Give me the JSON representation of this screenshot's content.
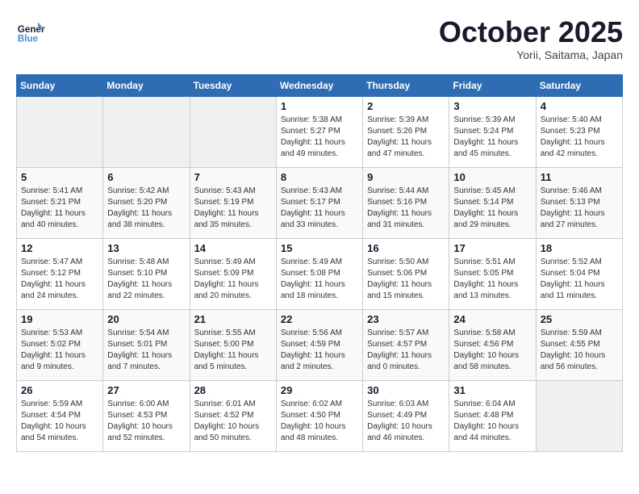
{
  "header": {
    "logo_line1": "General",
    "logo_line2": "Blue",
    "month": "October 2025",
    "location": "Yorii, Saitama, Japan"
  },
  "weekdays": [
    "Sunday",
    "Monday",
    "Tuesday",
    "Wednesday",
    "Thursday",
    "Friday",
    "Saturday"
  ],
  "weeks": [
    [
      {
        "day": "",
        "info": ""
      },
      {
        "day": "",
        "info": ""
      },
      {
        "day": "",
        "info": ""
      },
      {
        "day": "1",
        "info": "Sunrise: 5:38 AM\nSunset: 5:27 PM\nDaylight: 11 hours\nand 49 minutes."
      },
      {
        "day": "2",
        "info": "Sunrise: 5:39 AM\nSunset: 5:26 PM\nDaylight: 11 hours\nand 47 minutes."
      },
      {
        "day": "3",
        "info": "Sunrise: 5:39 AM\nSunset: 5:24 PM\nDaylight: 11 hours\nand 45 minutes."
      },
      {
        "day": "4",
        "info": "Sunrise: 5:40 AM\nSunset: 5:23 PM\nDaylight: 11 hours\nand 42 minutes."
      }
    ],
    [
      {
        "day": "5",
        "info": "Sunrise: 5:41 AM\nSunset: 5:21 PM\nDaylight: 11 hours\nand 40 minutes."
      },
      {
        "day": "6",
        "info": "Sunrise: 5:42 AM\nSunset: 5:20 PM\nDaylight: 11 hours\nand 38 minutes."
      },
      {
        "day": "7",
        "info": "Sunrise: 5:43 AM\nSunset: 5:19 PM\nDaylight: 11 hours\nand 35 minutes."
      },
      {
        "day": "8",
        "info": "Sunrise: 5:43 AM\nSunset: 5:17 PM\nDaylight: 11 hours\nand 33 minutes."
      },
      {
        "day": "9",
        "info": "Sunrise: 5:44 AM\nSunset: 5:16 PM\nDaylight: 11 hours\nand 31 minutes."
      },
      {
        "day": "10",
        "info": "Sunrise: 5:45 AM\nSunset: 5:14 PM\nDaylight: 11 hours\nand 29 minutes."
      },
      {
        "day": "11",
        "info": "Sunrise: 5:46 AM\nSunset: 5:13 PM\nDaylight: 11 hours\nand 27 minutes."
      }
    ],
    [
      {
        "day": "12",
        "info": "Sunrise: 5:47 AM\nSunset: 5:12 PM\nDaylight: 11 hours\nand 24 minutes."
      },
      {
        "day": "13",
        "info": "Sunrise: 5:48 AM\nSunset: 5:10 PM\nDaylight: 11 hours\nand 22 minutes."
      },
      {
        "day": "14",
        "info": "Sunrise: 5:49 AM\nSunset: 5:09 PM\nDaylight: 11 hours\nand 20 minutes."
      },
      {
        "day": "15",
        "info": "Sunrise: 5:49 AM\nSunset: 5:08 PM\nDaylight: 11 hours\nand 18 minutes."
      },
      {
        "day": "16",
        "info": "Sunrise: 5:50 AM\nSunset: 5:06 PM\nDaylight: 11 hours\nand 15 minutes."
      },
      {
        "day": "17",
        "info": "Sunrise: 5:51 AM\nSunset: 5:05 PM\nDaylight: 11 hours\nand 13 minutes."
      },
      {
        "day": "18",
        "info": "Sunrise: 5:52 AM\nSunset: 5:04 PM\nDaylight: 11 hours\nand 11 minutes."
      }
    ],
    [
      {
        "day": "19",
        "info": "Sunrise: 5:53 AM\nSunset: 5:02 PM\nDaylight: 11 hours\nand 9 minutes."
      },
      {
        "day": "20",
        "info": "Sunrise: 5:54 AM\nSunset: 5:01 PM\nDaylight: 11 hours\nand 7 minutes."
      },
      {
        "day": "21",
        "info": "Sunrise: 5:55 AM\nSunset: 5:00 PM\nDaylight: 11 hours\nand 5 minutes."
      },
      {
        "day": "22",
        "info": "Sunrise: 5:56 AM\nSunset: 4:59 PM\nDaylight: 11 hours\nand 2 minutes."
      },
      {
        "day": "23",
        "info": "Sunrise: 5:57 AM\nSunset: 4:57 PM\nDaylight: 11 hours\nand 0 minutes."
      },
      {
        "day": "24",
        "info": "Sunrise: 5:58 AM\nSunset: 4:56 PM\nDaylight: 10 hours\nand 58 minutes."
      },
      {
        "day": "25",
        "info": "Sunrise: 5:59 AM\nSunset: 4:55 PM\nDaylight: 10 hours\nand 56 minutes."
      }
    ],
    [
      {
        "day": "26",
        "info": "Sunrise: 5:59 AM\nSunset: 4:54 PM\nDaylight: 10 hours\nand 54 minutes."
      },
      {
        "day": "27",
        "info": "Sunrise: 6:00 AM\nSunset: 4:53 PM\nDaylight: 10 hours\nand 52 minutes."
      },
      {
        "day": "28",
        "info": "Sunrise: 6:01 AM\nSunset: 4:52 PM\nDaylight: 10 hours\nand 50 minutes."
      },
      {
        "day": "29",
        "info": "Sunrise: 6:02 AM\nSunset: 4:50 PM\nDaylight: 10 hours\nand 48 minutes."
      },
      {
        "day": "30",
        "info": "Sunrise: 6:03 AM\nSunset: 4:49 PM\nDaylight: 10 hours\nand 46 minutes."
      },
      {
        "day": "31",
        "info": "Sunrise: 6:04 AM\nSunset: 4:48 PM\nDaylight: 10 hours\nand 44 minutes."
      },
      {
        "day": "",
        "info": ""
      }
    ]
  ]
}
